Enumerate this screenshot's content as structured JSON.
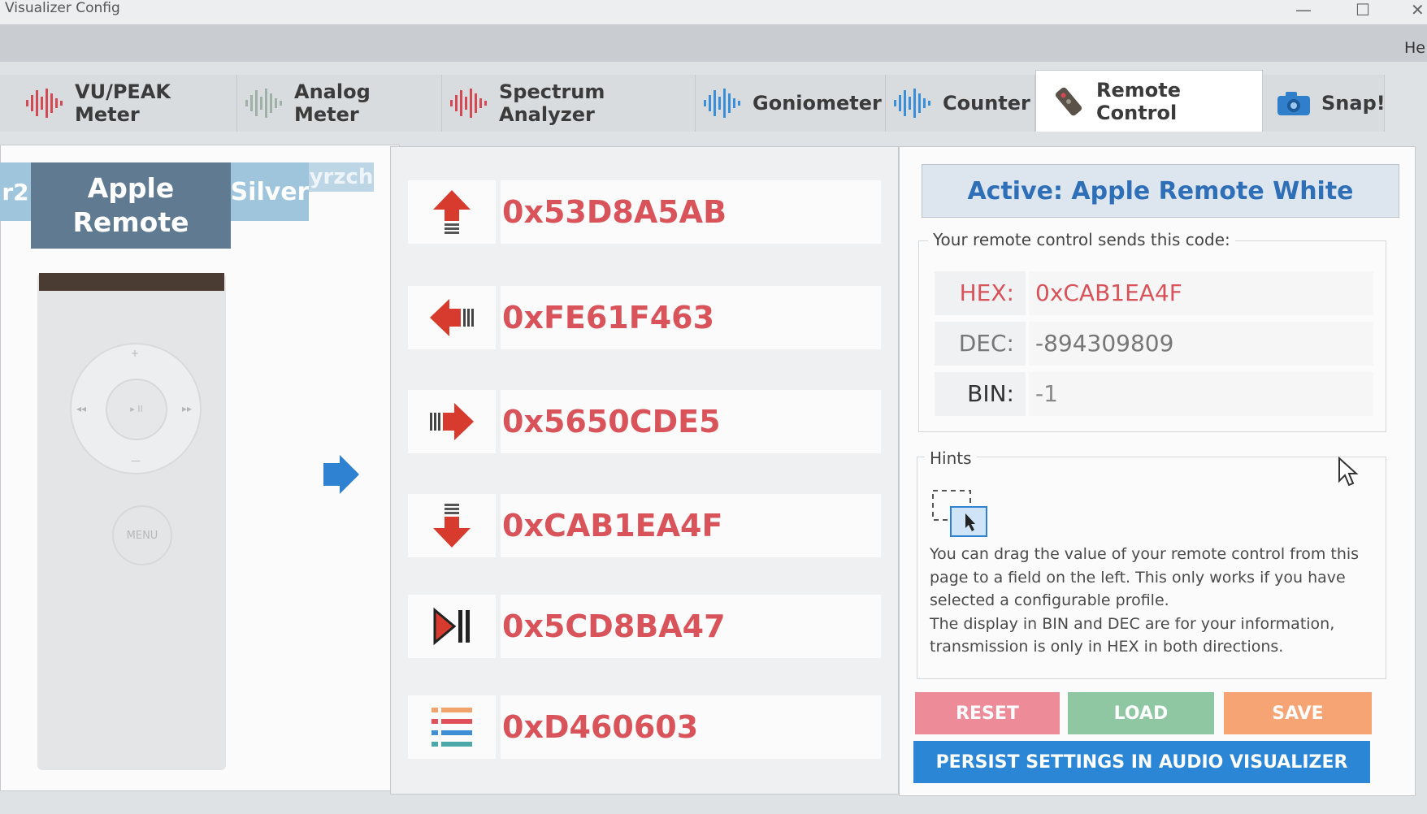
{
  "window": {
    "title": "Visualizer Config",
    "minimize": "—",
    "maximize": "☐",
    "close": "✕"
  },
  "menubar": {
    "help": "He"
  },
  "tabs": [
    {
      "label": "VU/PEAK Meter",
      "icon": "waveform-icon"
    },
    {
      "label": "Analog Meter",
      "icon": "waveform-icon"
    },
    {
      "label": "Spectrum Analyzer",
      "icon": "waveform-icon"
    },
    {
      "label": "Goniometer",
      "icon": "waveform-icon"
    },
    {
      "label": "Counter",
      "icon": "waveform-icon"
    },
    {
      "label": "Remote Control",
      "icon": "remote-icon",
      "active": true
    },
    {
      "label": "Snap!",
      "icon": "camera-icon"
    }
  ],
  "profiles": {
    "prev": "r2",
    "selected": "Apple\nRemote",
    "next": "Silver",
    "next2": "yrzch"
  },
  "remote": {
    "center_label": "▸ II",
    "menu_label": "MENU",
    "plus": "+",
    "minus": "—",
    "prev": "◂◂",
    "next": "▸▸"
  },
  "codes": [
    {
      "button": "up",
      "value": "0x53D8A5AB"
    },
    {
      "button": "left",
      "value": "0xFE61F463"
    },
    {
      "button": "right",
      "value": "0x5650CDE5"
    },
    {
      "button": "down",
      "value": "0xCAB1EA4F"
    },
    {
      "button": "play-pause",
      "value": "0x5CD8BA47"
    },
    {
      "button": "menu",
      "value": "0xD460603"
    }
  ],
  "active": {
    "title": "Active: Apple Remote White"
  },
  "code_group": {
    "legend": "Your remote control sends this code:",
    "hex_label": "HEX:",
    "hex_value": "0xCAB1EA4F",
    "dec_label": "DEC:",
    "dec_value": "-894309809",
    "bin_label": "BIN:",
    "bin_value": "-1"
  },
  "hints": {
    "legend": "Hints",
    "line1": "You can drag the value of your remote control from this",
    "line2": "page to a field on the left. This only works if you have",
    "line3": "selected a configurable profile.",
    "line4": "The display in BIN and DEC are for your information,",
    "line5": "transmission is only in HEX in both directions."
  },
  "buttons": {
    "reset": "RESET",
    "load": "LOAD",
    "save": "SAVE",
    "persist": "PERSIST SETTINGS IN AUDIO VISUALIZER"
  },
  "colors": {
    "accent_blue": "#2c86d6",
    "code_red": "#d9535a",
    "profile_dark": "#5f7a91",
    "profile_light": "#9fc5dd"
  }
}
